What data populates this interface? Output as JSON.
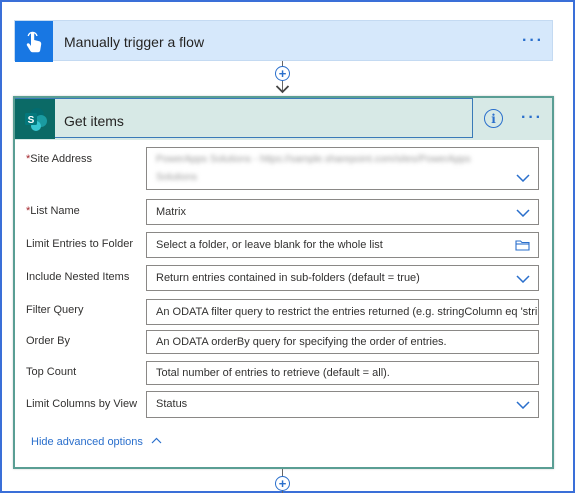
{
  "trigger": {
    "title": "Manually trigger a flow",
    "icon": "touch-hand-icon",
    "more_label": "···"
  },
  "connector": {
    "plus_label": "+"
  },
  "action": {
    "title": "Get items",
    "icon": "sharepoint-icon",
    "more_label": "···",
    "info_label": "i",
    "fields": [
      {
        "label": "Site Address",
        "required": true,
        "value": "PowerApps Solutions - https://sample.sharepoint.com/sites/PowerApps",
        "value_line2": "Solutions",
        "type": "dropdown"
      },
      {
        "label": "List Name",
        "required": true,
        "value": "Matrix",
        "type": "dropdown"
      },
      {
        "label": "Limit Entries to Folder",
        "required": false,
        "value": "Select a folder, or leave blank for the whole list",
        "type": "folder"
      },
      {
        "label": "Include Nested Items",
        "required": false,
        "value": "Return entries contained in sub-folders (default = true)",
        "type": "dropdown"
      },
      {
        "label": "Filter Query",
        "required": false,
        "value": "An ODATA filter query to restrict the entries returned (e.g. stringColumn eq 'stri",
        "type": "text"
      },
      {
        "label": "Order By",
        "required": false,
        "value": "An ODATA orderBy query for specifying the order of entries.",
        "type": "text"
      },
      {
        "label": "Top Count",
        "required": false,
        "value": "Total number of entries to retrieve (default = all).",
        "type": "text"
      },
      {
        "label": "Limit Columns by View",
        "required": false,
        "value": "Status",
        "type": "dropdown"
      }
    ],
    "hide_advanced": "Hide advanced options",
    "required_marker": "*"
  },
  "colors": {
    "trigger_bg": "#d6e8fb",
    "trigger_icon_bg": "#1877e3",
    "action_header_bg": "#d7e9e6",
    "sharepoint_icon_bg": "#0b6a66",
    "accent": "#2a6fcc",
    "required": "#a4262c"
  }
}
